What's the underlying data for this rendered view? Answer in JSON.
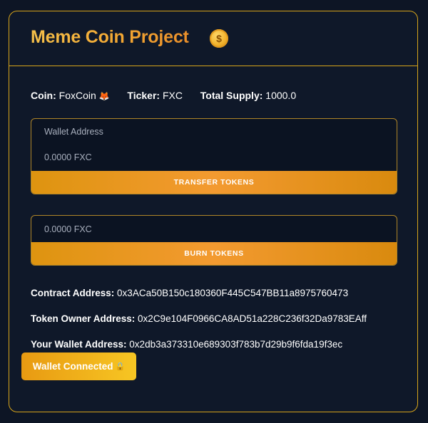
{
  "header": {
    "title": "Meme Coin Project",
    "icon": "dollar-coin-icon",
    "icon_glyph": "$"
  },
  "token_info": {
    "coin_label": "Coin:",
    "coin_value": "FoxCoin",
    "coin_emoji": "🦊",
    "ticker_label": "Ticker:",
    "ticker_value": "FXC",
    "supply_label": "Total Supply:",
    "supply_value": "1000.0"
  },
  "transfer_form": {
    "address_placeholder": "Wallet Address",
    "amount_placeholder": "0.0000 FXC",
    "button_label": "TRANSFER TOKENS"
  },
  "burn_form": {
    "amount_placeholder": "0.0000 FXC",
    "button_label": "BURN TOKENS"
  },
  "addresses": {
    "contract_label": "Contract Address:",
    "contract_value": "0x3ACa50B150c180360F445C547BB11a8975760473",
    "owner_label": "Token Owner Address:",
    "owner_value": "0x2C9e104F0966CA8AD51a228C236f32Da9783EAff",
    "wallet_label": "Your Wallet Address:",
    "wallet_value": "0x2db3a373310e689303f783b7d29b9f6fda19f3ec"
  },
  "wallet_button": {
    "label": "Wallet Connected",
    "icon": "lock-icon",
    "icon_glyph": "🔒"
  },
  "colors": {
    "background": "#0d1525",
    "accent_gold": "#d8a51a",
    "button_orange": "#f39a30"
  }
}
